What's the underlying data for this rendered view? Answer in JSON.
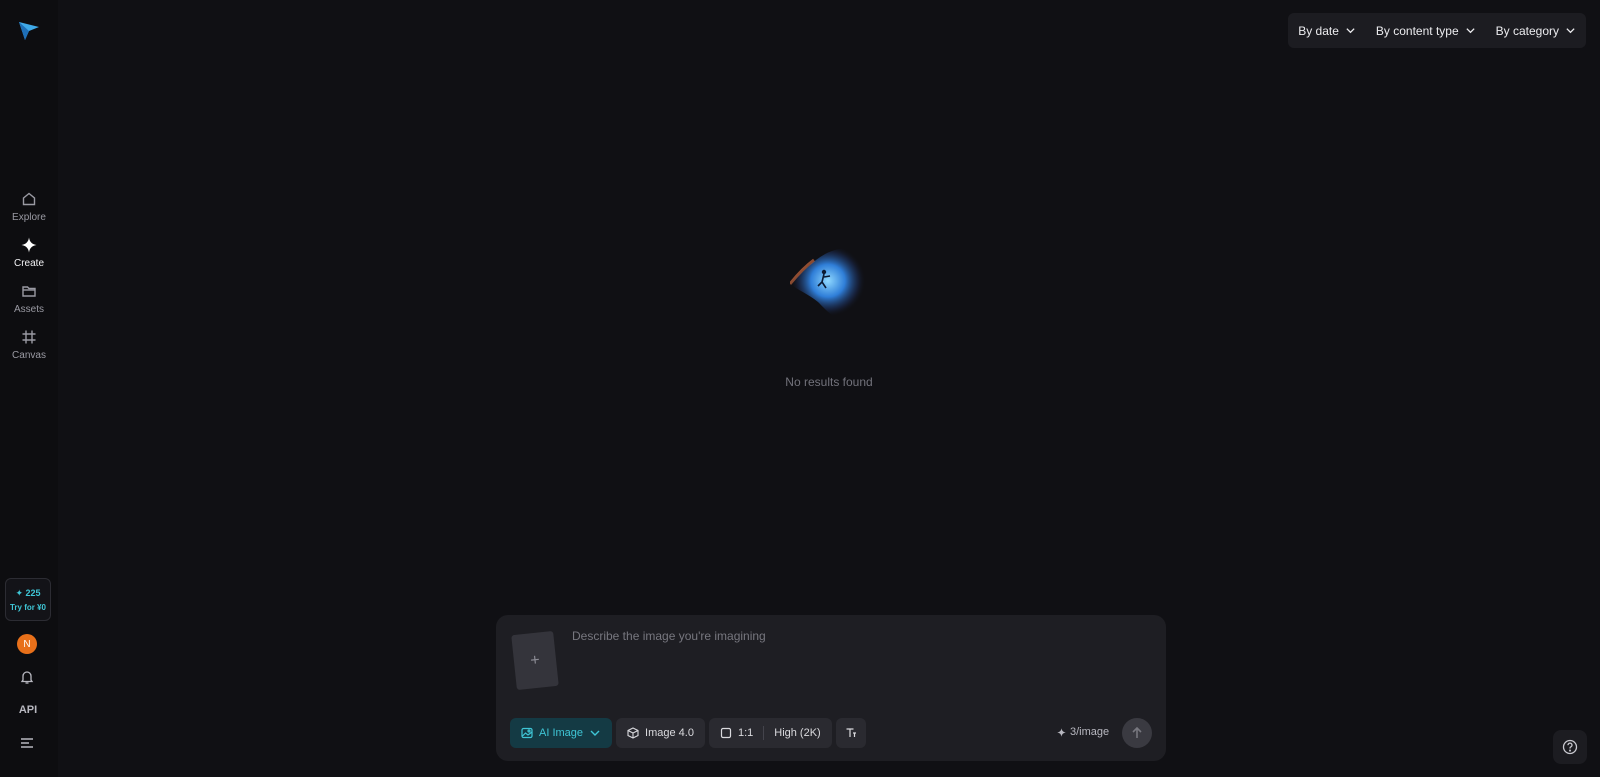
{
  "sidebar": {
    "logo_icon": "paper-plane-logo",
    "items": [
      {
        "label": "Explore",
        "icon": "home-icon"
      },
      {
        "label": "Create",
        "icon": "sparkle-icon"
      },
      {
        "label": "Assets",
        "icon": "folder-icon"
      },
      {
        "label": "Canvas",
        "icon": "crop-icon"
      }
    ],
    "credits": {
      "count": "✦ 225",
      "cta": "Try for ¥0"
    },
    "avatar_initial": "N",
    "api_label": "API"
  },
  "filters": {
    "date": "By date",
    "content_type": "By content type",
    "category": "By category"
  },
  "empty_state": {
    "message": "No results found"
  },
  "composer": {
    "placeholder": "Describe the image you're imagining",
    "upload_glyph": "+",
    "mode": "AI Image",
    "model": "Image 4.0",
    "aspect": "1:1",
    "quality": "High (2K)",
    "cost": "3/image"
  },
  "colors": {
    "accent": "#3fc6d6",
    "avatar": "#e8701a",
    "background": "#101014"
  }
}
